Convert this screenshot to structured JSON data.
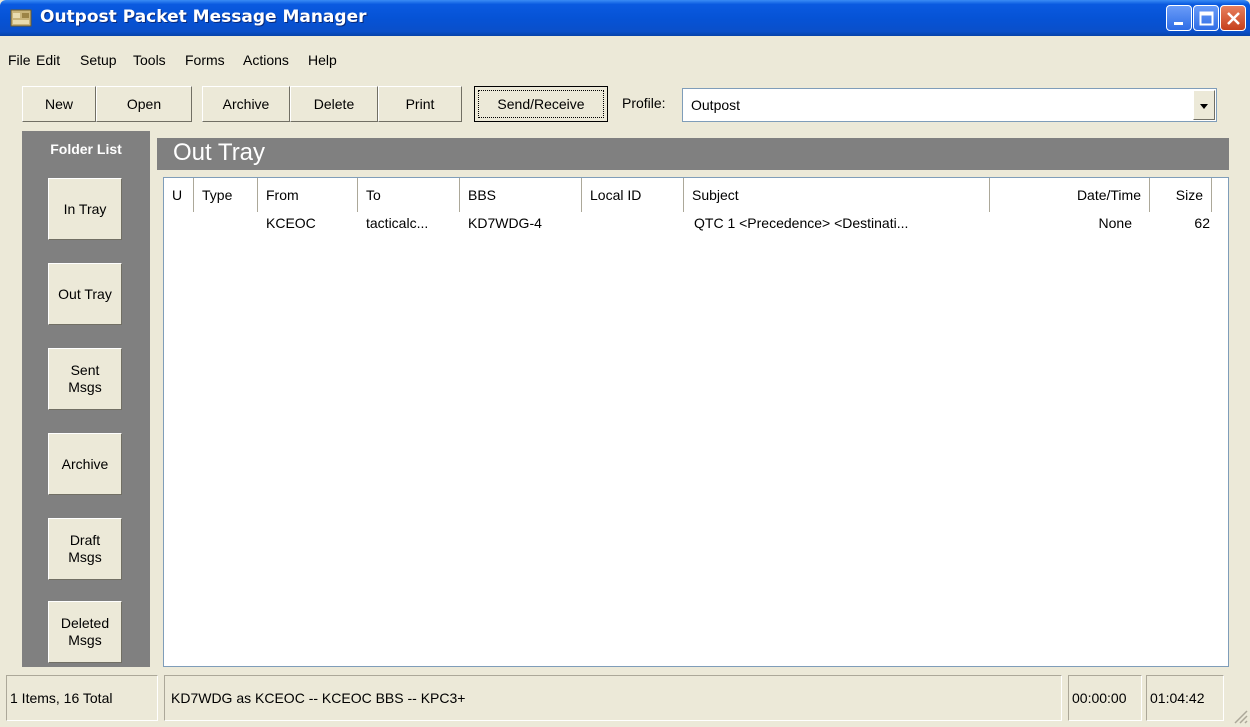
{
  "window": {
    "title": "Outpost Packet Message Manager"
  },
  "menu": [
    "File",
    "Edit",
    "Setup",
    "Tools",
    "Forms",
    "Actions",
    "Help"
  ],
  "toolbar": {
    "new": "New",
    "open": "Open",
    "archive": "Archive",
    "delete": "Delete",
    "print": "Print",
    "send_receive": "Send/Receive",
    "profile_label": "Profile:",
    "profile_value": "Outpost"
  },
  "folders": {
    "header": "Folder List",
    "items": [
      "In Tray",
      "Out Tray",
      "Sent\nMsgs",
      "Archive",
      "Draft\nMsgs",
      "Deleted\nMsgs"
    ]
  },
  "tray": {
    "title": "Out Tray"
  },
  "table": {
    "columns": [
      "U",
      "Type",
      "From",
      "To",
      "BBS",
      "Local ID",
      "Subject",
      "Date/Time",
      "Size"
    ],
    "rows": [
      {
        "u": "",
        "type": "",
        "from": "KCEOC",
        "to": "tacticalc...",
        "bbs": "KD7WDG-4",
        "local_id": "",
        "subject": "QTC 1 <Precedence> <Destinati...",
        "datetime": "None",
        "size": "62"
      }
    ]
  },
  "status": {
    "count": "1 Items, 16 Total",
    "info": "KD7WDG as KCEOC -- KCEOC BBS -- KPC3+",
    "timer": "00:00:00",
    "clock": "01:04:42"
  },
  "colors": {
    "titlebar": "#0653d6",
    "panel": "#808080",
    "window": "#ece9d8"
  }
}
